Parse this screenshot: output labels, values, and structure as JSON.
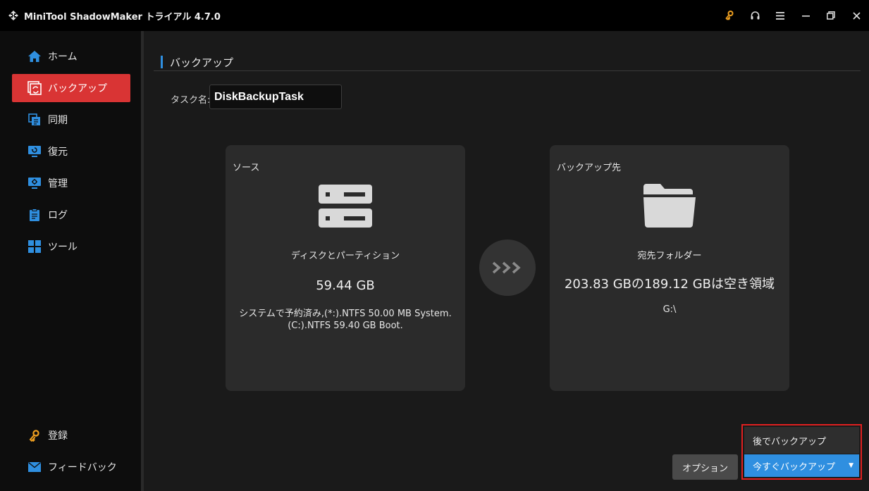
{
  "window": {
    "title": "MiniTool ShadowMaker トライアル 4.7.0",
    "controls": [
      "key-icon",
      "headset-icon",
      "menu-icon",
      "minimize-icon",
      "restore-icon",
      "close-icon"
    ],
    "accent_key": "#f0a020"
  },
  "sidebar": {
    "items": [
      {
        "label": "ホーム",
        "icon": "home-icon"
      },
      {
        "label": "バックアップ",
        "icon": "backup-icon",
        "active": true
      },
      {
        "label": "同期",
        "icon": "sync-icon"
      },
      {
        "label": "復元",
        "icon": "restore-icon"
      },
      {
        "label": "管理",
        "icon": "manage-icon"
      },
      {
        "label": "ログ",
        "icon": "log-icon"
      },
      {
        "label": "ツール",
        "icon": "tools-icon"
      }
    ],
    "bottom": [
      {
        "label": "登録",
        "icon": "key-icon"
      },
      {
        "label": "フィードバック",
        "icon": "mail-icon"
      }
    ],
    "active_color": "#d93434"
  },
  "main": {
    "header": "バックアップ",
    "task_label": "タスク名:",
    "task_value": "DiskBackupTask",
    "source": {
      "title": "ソース",
      "label": "ディスクとパーティション",
      "size": "59.44 GB",
      "detail_line1": "システムで予約済み,(*:).NTFS 50.00 MB System.",
      "detail_line2": "(C:).NTFS 59.40 GB Boot."
    },
    "destination": {
      "title": "バックアップ先",
      "label": "宛先フォルダー",
      "space": "203.83 GBの189.12 GBは空き領域",
      "path": "G:\\"
    },
    "buttons": {
      "options": "オプション",
      "backup_later": "後でバックアップ",
      "backup_now": "今すぐバックアップ"
    },
    "accent_color": "#2f8fe0"
  }
}
